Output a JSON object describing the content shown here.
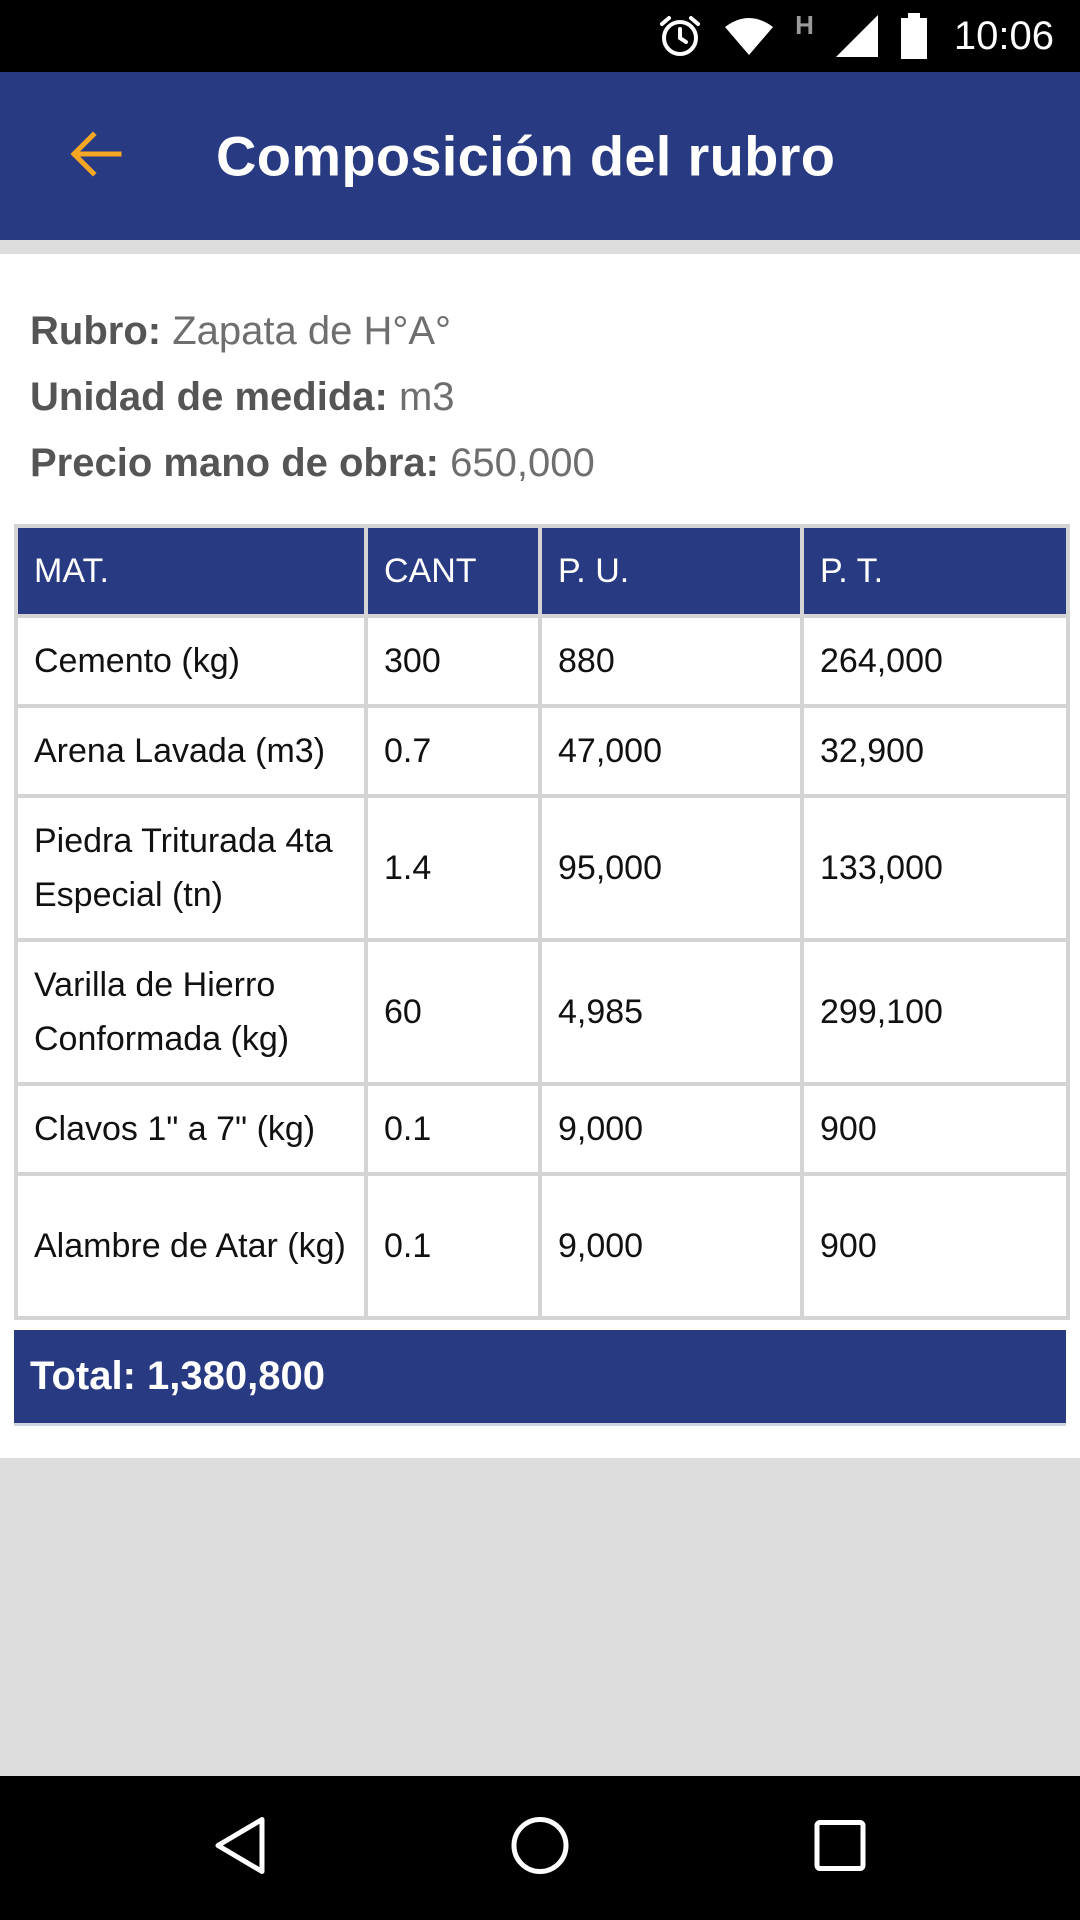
{
  "status_bar": {
    "network_letter": "H",
    "time": "10:06",
    "icons": [
      "alarm-icon",
      "wifi-icon",
      "signal-icon",
      "battery-icon"
    ]
  },
  "app_bar": {
    "back_icon": "arrow-left-icon",
    "title": "Composición del rubro",
    "accent_color": "#f5a623",
    "background_color": "#283a82"
  },
  "info": {
    "rubro_label": "Rubro:",
    "rubro_value": "Zapata de H°A°",
    "unidad_label": "Unidad de medida:",
    "unidad_value": "m3",
    "precio_label": "Precio mano de obra:",
    "precio_value": "650,000"
  },
  "table": {
    "headers": [
      "MAT.",
      "CANT",
      "P. U.",
      "P. T."
    ],
    "rows": [
      [
        "Cemento (kg)",
        "300",
        "880",
        "264,000"
      ],
      [
        "Arena Lavada (m3)",
        "0.7",
        "47,000",
        "32,900"
      ],
      [
        "Piedra Triturada 4ta Especial (tn)",
        "1.4",
        "95,000",
        "133,000"
      ],
      [
        "Varilla de Hierro Conformada (kg)",
        "60",
        "4,985",
        "299,100"
      ],
      [
        "Clavos 1\" a 7\" (kg)",
        "0.1",
        "9,000",
        "900"
      ],
      [
        "Alambre de Atar (kg)",
        "0.1",
        "9,000",
        "900"
      ]
    ]
  },
  "total": {
    "label": "Total: 1,380,800"
  },
  "nav_bar": {
    "icons": [
      "back-triangle-icon",
      "home-circle-icon",
      "recents-square-icon"
    ]
  }
}
